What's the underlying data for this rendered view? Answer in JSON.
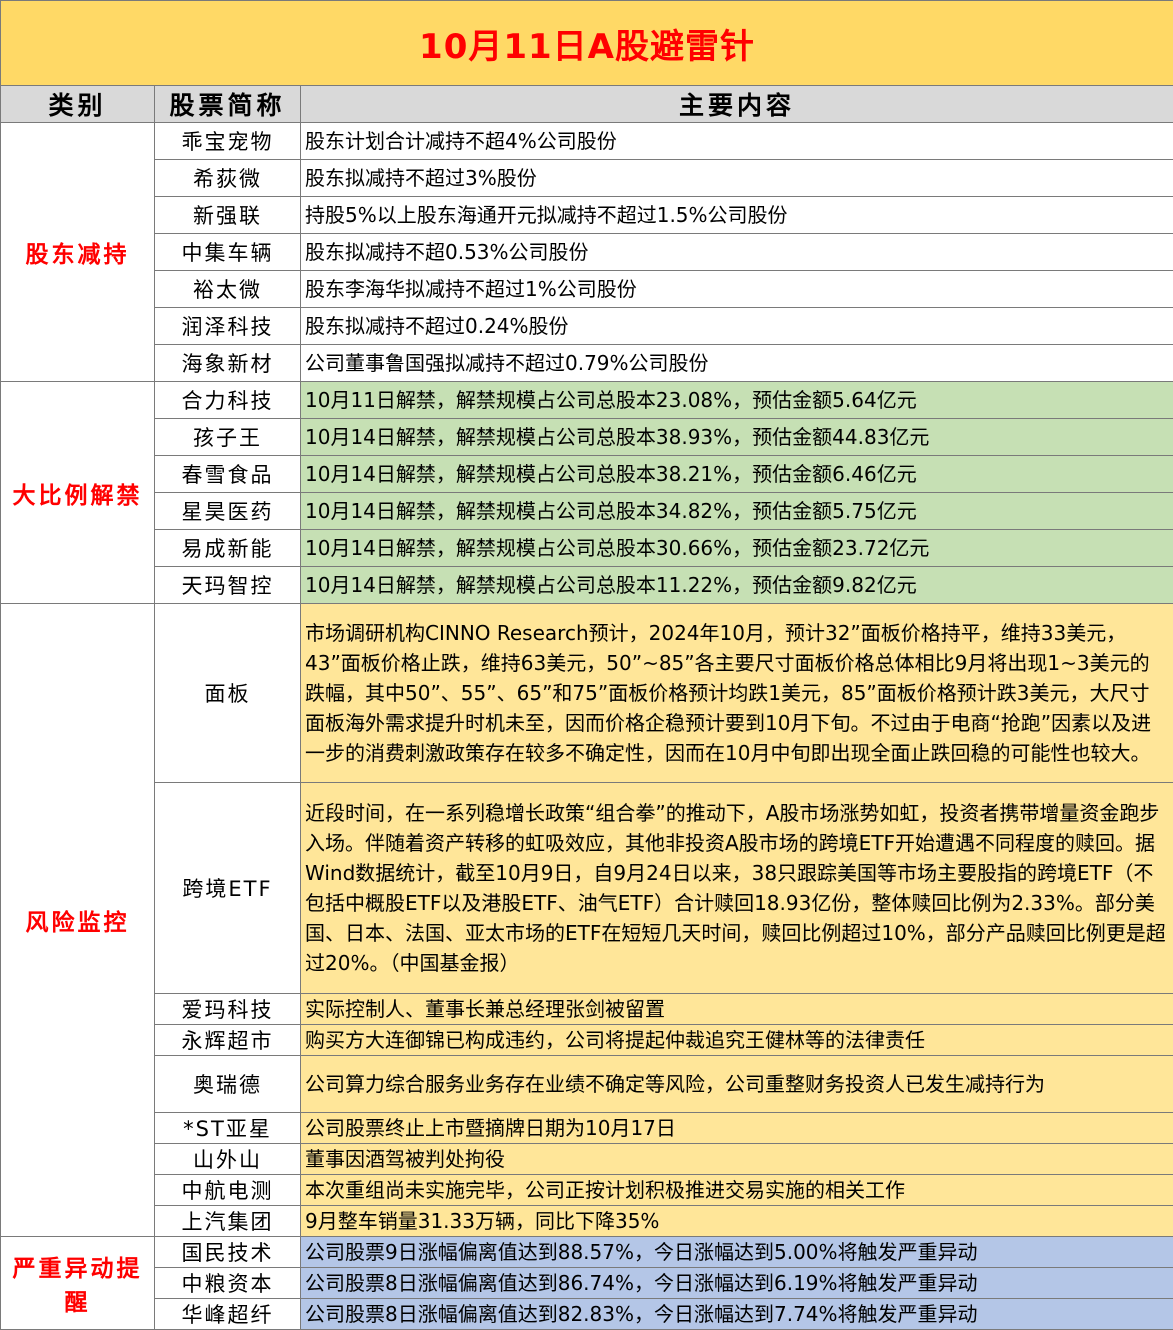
{
  "title": "10月11日A股避雷针",
  "headers": {
    "category": "类别",
    "stock": "股票简称",
    "content": "主要内容"
  },
  "groups": {
    "reduce": {
      "label": "股东减持",
      "rows": [
        {
          "name": "乖宝宠物",
          "text": "股东计划合计减持不超4%公司股份"
        },
        {
          "name": "希荻微",
          "text": "股东拟减持不超过3%股份"
        },
        {
          "name": "新强联",
          "text": "持股5%以上股东海通开元拟减持不超过1.5%公司股份"
        },
        {
          "name": "中集车辆",
          "text": "股东拟减持不超0.53%公司股份"
        },
        {
          "name": "裕太微",
          "text": "股东李海华拟减持不超过1%公司股份"
        },
        {
          "name": "润泽科技",
          "text": "股东拟减持不超过0.24%股份"
        },
        {
          "name": "海象新材",
          "text": "公司董事鲁国强拟减持不超过0.79%公司股份"
        }
      ]
    },
    "unlock": {
      "label": "大比例解禁",
      "rows": [
        {
          "name": "合力科技",
          "text": "10月11日解禁，解禁规模占公司总股本23.08%，预估金额5.64亿元"
        },
        {
          "name": "孩子王",
          "text": "10月14日解禁，解禁规模占公司总股本38.93%，预估金额44.83亿元"
        },
        {
          "name": "春雪食品",
          "text": "10月14日解禁，解禁规模占公司总股本38.21%，预估金额6.46亿元"
        },
        {
          "name": "星昊医药",
          "text": "10月14日解禁，解禁规模占公司总股本34.82%，预估金额5.75亿元"
        },
        {
          "name": "易成新能",
          "text": "10月14日解禁，解禁规模占公司总股本30.66%，预估金额23.72亿元"
        },
        {
          "name": "天玛智控",
          "text": "10月14日解禁，解禁规模占公司总股本11.22%，预估金额9.82亿元"
        }
      ]
    },
    "risk": {
      "label": "风险监控",
      "rows": [
        {
          "name": "面板",
          "text": "市场调研机构CINNO Research预计，2024年10月，预计32”面板价格持平，维持33美元，43”面板价格止跌，维持63美元，50”~85”各主要尺寸面板价格总体相比9月将出现1~3美元的跌幅，其中50”、55”、65”和75”面板价格预计均跌1美元，85”面板价格预计跌3美元，大尺寸面板海外需求提升时机未至，因而价格企稳预计要到10月下旬。不过由于电商“抢跑”因素以及进一步的消费刺激政策存在较多不确定性，因而在10月中旬即出现全面止跌回稳的可能性也较大。"
        },
        {
          "name": "跨境ETF",
          "text": "近段时间，在一系列稳增长政策“组合拳”的推动下，A股市场涨势如虹，投资者携带增量资金跑步入场。伴随着资产转移的虹吸效应，其他非投资A股市场的跨境ETF开始遭遇不同程度的赎回。据Wind数据统计，截至10月9日，自9月24日以来，38只跟踪美国等市场主要股指的跨境ETF（不包括中概股ETF以及港股ETF、油气ETF）合计赎回18.93亿份，整体赎回比例为2.33%。部分美国、日本、法国、亚太市场的ETF在短短几天时间，赎回比例超过10%，部分产品赎回比例更是超过20%。（中国基金报）"
        },
        {
          "name": "爱玛科技",
          "text": "实际控制人、董事长兼总经理张剑被留置"
        },
        {
          "name": "永辉超市",
          "text": "购买方大连御锦已构成违约，公司将提起仲裁追究王健林等的法律责任"
        },
        {
          "name": "奥瑞德",
          "text": "公司算力综合服务业务存在业绩不确定等风险，公司重整财务投资人已发生减持行为"
        },
        {
          "name": "*ST亚星",
          "text": "公司股票终止上市暨摘牌日期为10月17日"
        },
        {
          "name": "山外山",
          "text": "董事因酒驾被判处拘役"
        },
        {
          "name": "中航电测",
          "text": "本次重组尚未实施完毕，公司正按计划积极推进交易实施的相关工作"
        },
        {
          "name": "上汽集团",
          "text": "9月整车销量31.33万辆，同比下降35%"
        }
      ]
    },
    "abnormal": {
      "label": "严重异动提醒",
      "rows": [
        {
          "name": "国民技术",
          "text": "公司股票9日涨幅偏离值达到88.57%，今日涨幅达到5.00%将触发严重异动"
        },
        {
          "name": "中粮资本",
          "text": "公司股票8日涨幅偏离值达到86.74%，今日涨幅达到6.19%将触发严重异动"
        },
        {
          "name": "华峰超纤",
          "text": "公司股票8日涨幅偏离值达到82.83%，今日涨幅达到7.74%将触发严重异动"
        }
      ]
    }
  },
  "colors": {
    "title_bg": "#ffd966",
    "title_text": "#ff0000",
    "header_bg": "#d9d9d9",
    "category_text": "#ff0000",
    "unlock_bg": "#c6e0b4",
    "risk_bg": "#ffe699",
    "abnormal_bg": "#b4c6e7"
  }
}
